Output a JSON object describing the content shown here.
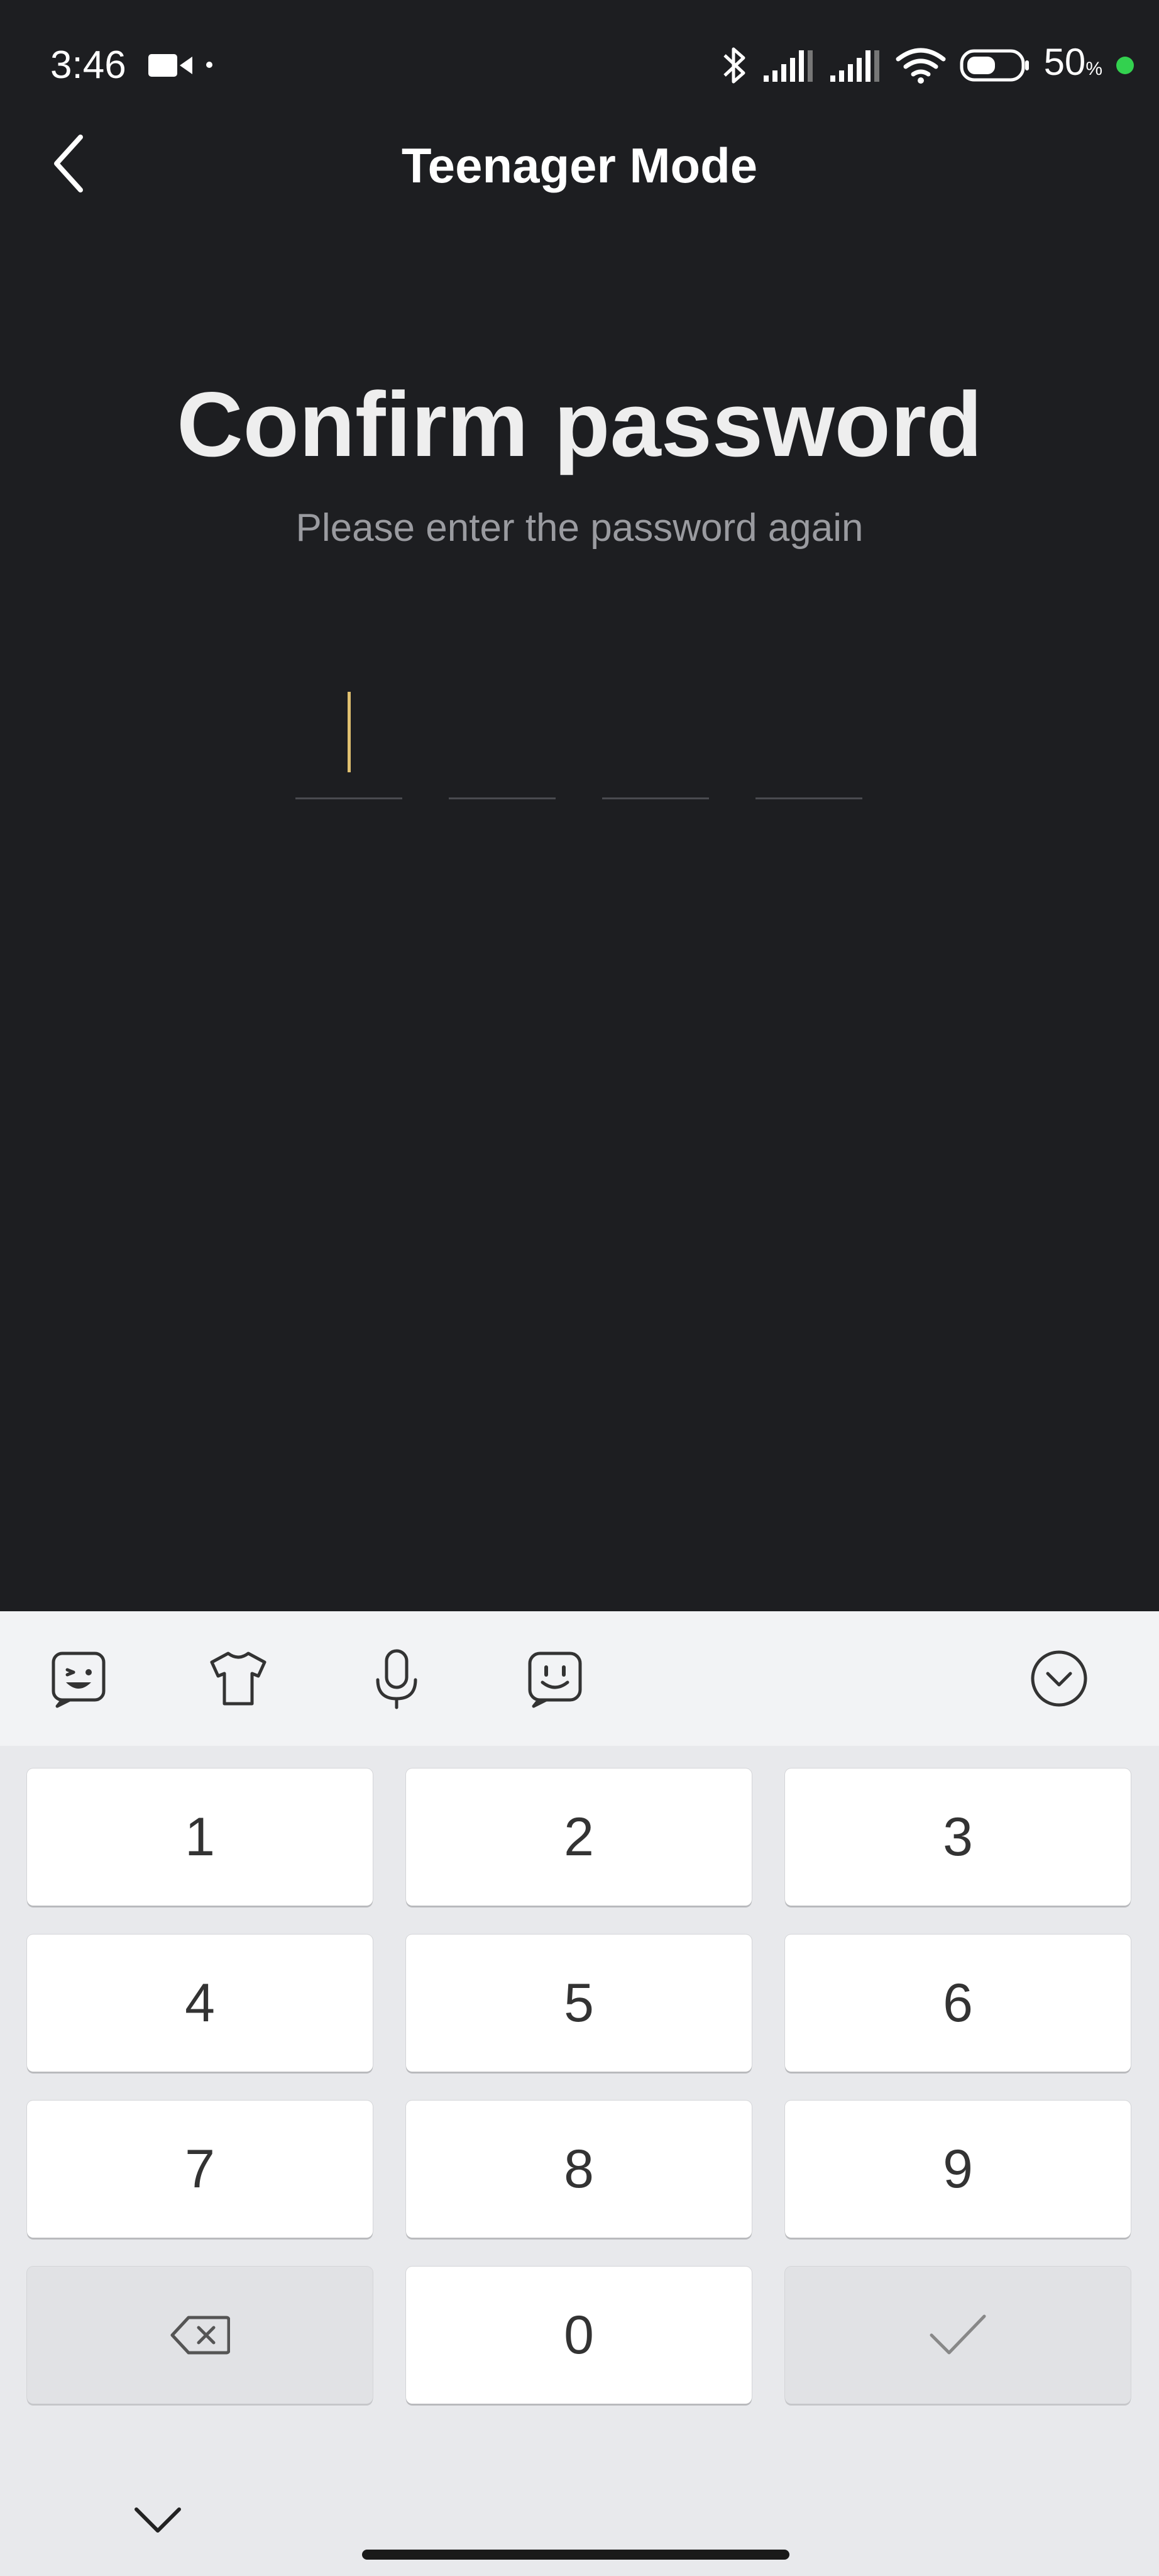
{
  "status_bar": {
    "time": "3:46",
    "battery_value": "50",
    "battery_unit": "%",
    "icons": [
      "video-camera-icon",
      "bluetooth-icon",
      "signal-icon",
      "signal-icon",
      "wifi-icon",
      "battery-icon"
    ],
    "charge_dot_color": "#33d14f"
  },
  "header": {
    "title": "Teenager Mode",
    "back_icon": "chevron-left-icon"
  },
  "main": {
    "title": "Confirm password",
    "subtitle": "Please enter the password again",
    "pin_length": 4,
    "pin_entered": 0,
    "cursor_color": "#e0c070"
  },
  "keyboard": {
    "toolbar": [
      "emoji-icon",
      "shirt-icon",
      "microphone-icon",
      "sticker-icon",
      "collapse-circle-icon"
    ],
    "keys": {
      "k1": "1",
      "k2": "2",
      "k3": "3",
      "k4": "4",
      "k5": "5",
      "k6": "6",
      "k7": "7",
      "k8": "8",
      "k9": "9",
      "k0": "0"
    },
    "special_keys": [
      "backspace-icon",
      "checkmark-icon",
      "chevron-down-icon"
    ]
  },
  "colors": {
    "background": "#1d1e21",
    "keyboard_background": "#e8e9ec",
    "key_background": "#ffffff"
  }
}
